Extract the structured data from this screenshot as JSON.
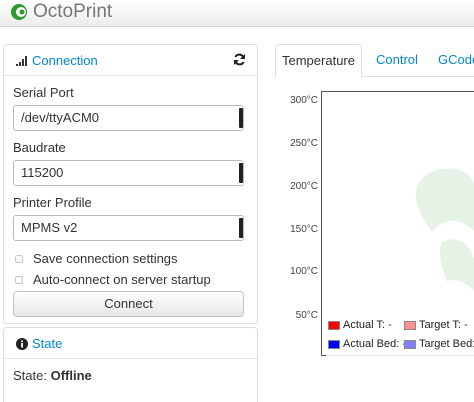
{
  "navbar": {
    "brand": "OctoPrint",
    "brand_icon": "octoprint-logo-icon"
  },
  "connection": {
    "title": "Connection",
    "serial_port": {
      "label": "Serial Port",
      "value": "/dev/ttyACM0"
    },
    "baudrate": {
      "label": "Baudrate",
      "value": "115200"
    },
    "printer_profile": {
      "label": "Printer Profile",
      "value": "MPMS v2"
    },
    "save_settings_label": "Save connection settings",
    "autoconnect_label": "Auto-connect on server startup",
    "connect_button": "Connect"
  },
  "state": {
    "title": "State",
    "label": "State:",
    "value": "Offline"
  },
  "tabs": [
    {
      "label": "Temperature",
      "active": true
    },
    {
      "label": "Control"
    },
    {
      "label": "GCode"
    }
  ],
  "graph": {
    "y_ticks": [
      "300°C",
      "250°C",
      "200°C",
      "150°C",
      "100°C",
      "50°C"
    ],
    "legend": [
      {
        "label": "Actual T: -",
        "color": "#ff0000"
      },
      {
        "label": "Target T: -",
        "color": "#ff8f8f"
      },
      {
        "label": "Actual Bed: -",
        "color": "#0000ff"
      },
      {
        "label": "Target Bed: -",
        "color": "#8080ff"
      }
    ]
  },
  "colors": {
    "link": "#0088cc",
    "logo_green": "#33aa33"
  }
}
